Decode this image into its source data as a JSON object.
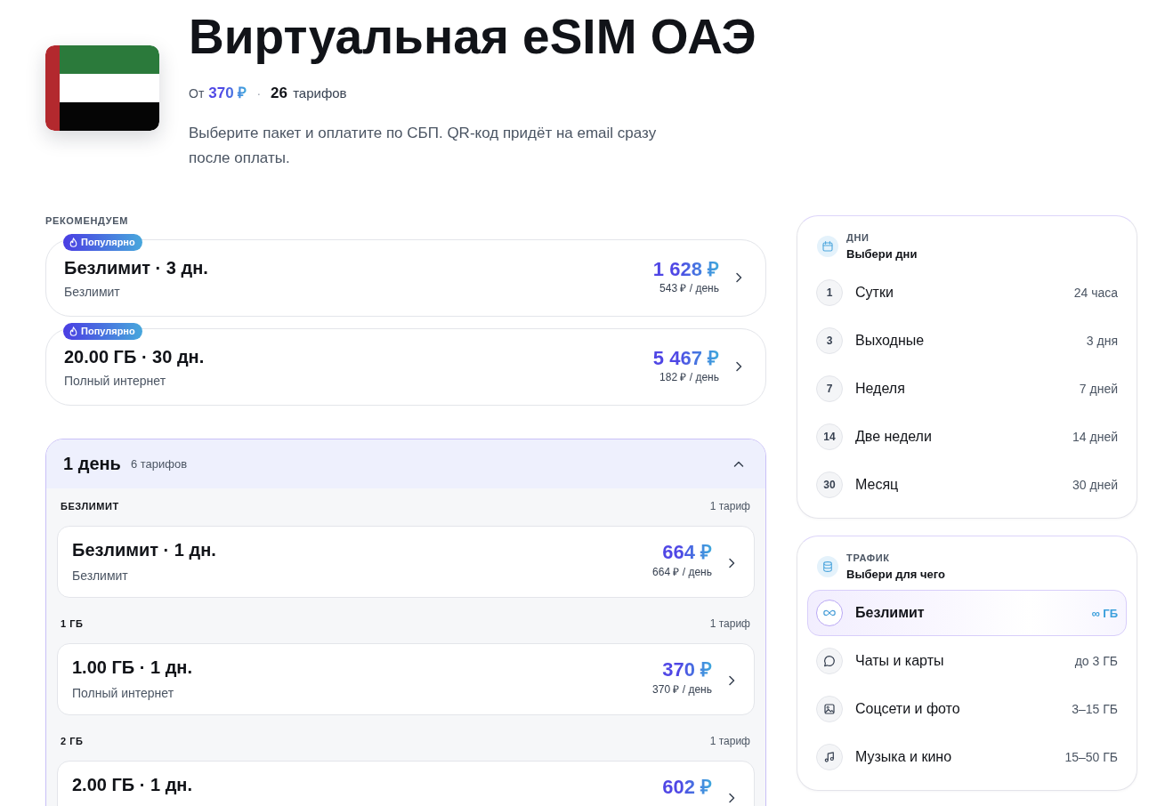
{
  "header": {
    "title": "Виртуальная eSIM ОАЭ",
    "price_prefix": "От",
    "price": "370 ₽",
    "separator": "·",
    "plan_count": "**26** тарифов",
    "description": "Выберите пакет и оплатите по СБП. QR-код придёт на email сразу после оплаты."
  },
  "recommended": {
    "heading": "РЕКОМЕНДУЕМ",
    "plans": [
      {
        "badge": "Популярно",
        "title": "Безлимит · 3 дн.",
        "subtitle": "Безлимит",
        "price": "1 628 ₽",
        "per_day": "543 ₽ / день"
      },
      {
        "badge": "Популярно",
        "title": "20.00 ГБ · 30 дн.",
        "subtitle": "Полный интернет",
        "price": "5 467 ₽",
        "per_day": "182 ₽ / день"
      }
    ]
  },
  "accordion": {
    "title": "1 день",
    "count": "6 тарифов",
    "expanded": true,
    "groups": [
      {
        "heading": "БЕЗЛИМИТ",
        "count": "1 тариф",
        "plans": [
          {
            "title": "Безлимит · 1 дн.",
            "subtitle": "Безлимит",
            "price": "664 ₽",
            "per_day": "664 ₽ / день"
          }
        ]
      },
      {
        "heading": "1 ГБ",
        "count": "1 тариф",
        "plans": [
          {
            "title": "1.00 ГБ · 1 дн.",
            "subtitle": "Полный интернет",
            "price": "370 ₽",
            "per_day": "370 ₽ / день"
          }
        ]
      },
      {
        "heading": "2 ГБ",
        "count": "1 тариф",
        "plans": [
          {
            "title": "2.00 ГБ · 1 дн.",
            "price": "602 ₽"
          }
        ]
      }
    ]
  },
  "sidebar": {
    "days": {
      "label": "ДНИ",
      "title": "Выбери дни",
      "items": [
        {
          "number": "1",
          "label": "Сутки",
          "value": "24 часа",
          "selected": false
        },
        {
          "number": "3",
          "label": "Выходные",
          "value": "3 дня",
          "selected": false
        },
        {
          "number": "7",
          "label": "Неделя",
          "value": "7 дней",
          "selected": false
        },
        {
          "number": "14",
          "label": "Две недели",
          "value": "14 дней",
          "selected": false
        },
        {
          "number": "30",
          "label": "Месяц",
          "value": "30 дней",
          "selected": false
        }
      ]
    },
    "traffic": {
      "label": "ТРАФИК",
      "title": "Выбери для чего",
      "items": [
        {
          "kind": "unlimited",
          "label": "Безлимит",
          "value": "∞ ГБ",
          "selected": true
        },
        {
          "kind": "chat",
          "label": "Чаты и карты",
          "value": "до 3 ГБ",
          "selected": false
        },
        {
          "kind": "photo",
          "label": "Соцсети и фото",
          "value": "3–15 ГБ",
          "selected": false
        },
        {
          "kind": "music",
          "label": "Музыка и кино",
          "value": "15–50 ГБ",
          "selected": false
        }
      ]
    }
  }
}
